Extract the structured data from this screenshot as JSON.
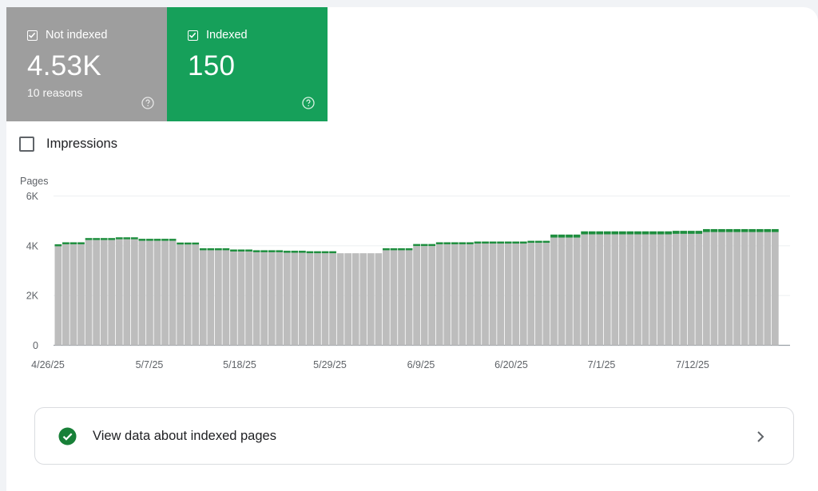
{
  "tiles": {
    "not_indexed": {
      "label": "Not indexed",
      "count": "4.53K",
      "sub": "10 reasons",
      "color": "#9e9e9e",
      "help_icon": "help-circle-icon"
    },
    "indexed": {
      "label": "Indexed",
      "count": "150",
      "color": "#16a05a",
      "help_icon": "help-circle-icon"
    }
  },
  "impressions": {
    "label": "Impressions",
    "checked": false
  },
  "chart_data": {
    "type": "bar",
    "stacked": true,
    "ylabel": "Pages",
    "yticks": [
      "0",
      "2K",
      "4K",
      "6K"
    ],
    "ylim": [
      0,
      6000
    ],
    "xtick_labels": [
      "4/26/25",
      "5/7/25",
      "5/18/25",
      "5/29/25",
      "6/9/25",
      "6/20/25",
      "7/1/25",
      "7/12/25"
    ],
    "grid": true,
    "series": [
      {
        "color": "#bdbdbd",
        "values": [
          3980,
          4060,
          4060,
          4060,
          4230,
          4230,
          4230,
          4230,
          4260,
          4260,
          4260,
          4200,
          4200,
          4200,
          4200,
          4200,
          4050,
          4050,
          4050,
          3820,
          3820,
          3820,
          3820,
          3770,
          3770,
          3770,
          3740,
          3740,
          3740,
          3740,
          3720,
          3720,
          3720,
          3700,
          3700,
          3700,
          3700,
          3700,
          3700,
          3700,
          3700,
          3700,
          3700,
          3820,
          3820,
          3820,
          3820,
          3990,
          3990,
          3990,
          4060,
          4060,
          4060,
          4060,
          4060,
          4090,
          4090,
          4090,
          4090,
          4090,
          4090,
          4090,
          4120,
          4120,
          4120,
          4330,
          4330,
          4330,
          4330,
          4460,
          4460,
          4460,
          4460,
          4460,
          4460,
          4460,
          4460,
          4460,
          4460,
          4460,
          4460,
          4480,
          4480,
          4480,
          4480,
          4550,
          4550,
          4550,
          4550,
          4550,
          4550,
          4550,
          4550,
          4550,
          4550
        ]
      },
      {
        "color": "#1e8e3e",
        "values": [
          80,
          80,
          80,
          80,
          80,
          80,
          80,
          80,
          80,
          80,
          80,
          80,
          80,
          80,
          80,
          80,
          80,
          80,
          80,
          80,
          80,
          80,
          80,
          80,
          80,
          80,
          80,
          80,
          80,
          80,
          80,
          80,
          80,
          80,
          80,
          80,
          80,
          0,
          0,
          0,
          0,
          0,
          0,
          80,
          80,
          80,
          80,
          80,
          80,
          80,
          80,
          80,
          80,
          80,
          80,
          80,
          80,
          80,
          80,
          80,
          80,
          80,
          80,
          80,
          80,
          120,
          120,
          120,
          120,
          120,
          120,
          120,
          120,
          120,
          120,
          120,
          120,
          120,
          120,
          120,
          120,
          120,
          120,
          120,
          120,
          120,
          120,
          120,
          120,
          120,
          120,
          120,
          120,
          120,
          120
        ]
      }
    ]
  },
  "view_button": {
    "label": "View data about indexed pages",
    "status_icon": "check-circle-icon",
    "chevron_icon": "chevron-right-icon"
  }
}
